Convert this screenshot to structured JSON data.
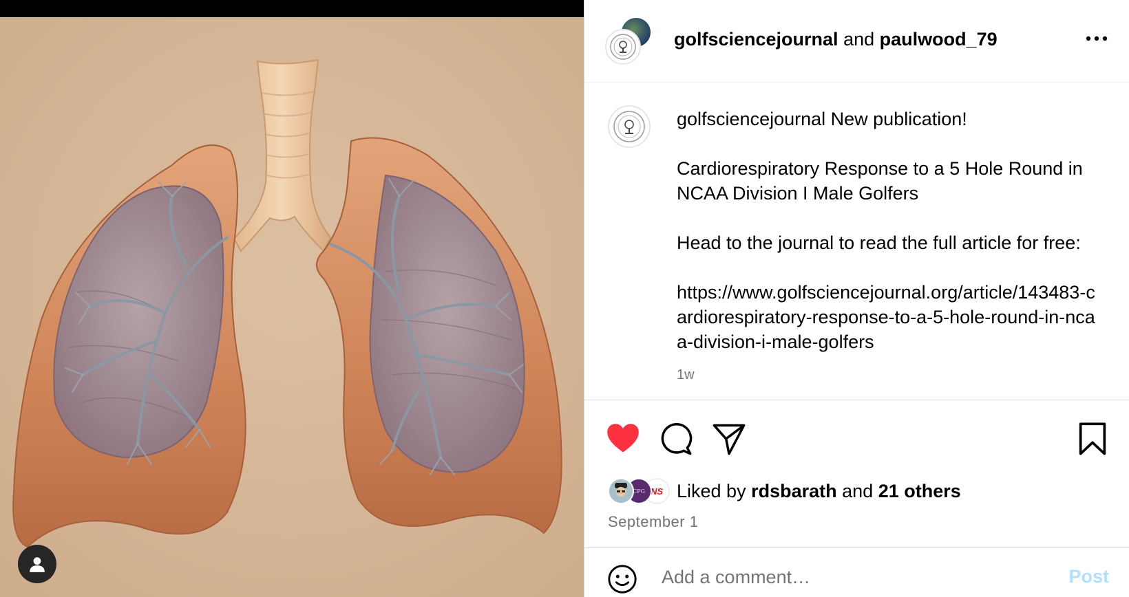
{
  "header": {
    "user1": "golfsciencejournal",
    "joiner": "and",
    "user2": "paulwood_79"
  },
  "caption": {
    "username": "golfsciencejournal",
    "line1": "New publication!",
    "title": "Cardiorespiratory Response to a 5 Hole Round in NCAA Division I Male Golfers",
    "cta": "Head to the journal to read the full article for free:",
    "link": "https://www.golfsciencejournal.org/article/143483-cardiorespiratory-response-to-a-5-hole-round-in-ncaa-division-i-male-golfers",
    "time": "1w"
  },
  "actions": {
    "like_icon": "heart-filled-icon",
    "comment_icon": "comment-icon",
    "share_icon": "send-icon",
    "save_icon": "bookmark-icon",
    "like_color": "#ff3040"
  },
  "likes": {
    "prefix": "Liked by",
    "user": "rdsbarath",
    "joiner": "and",
    "others": "21 others",
    "avatar_badges": [
      "",
      "CPG",
      "NS"
    ]
  },
  "date": "September 1",
  "comment": {
    "placeholder": "Add a comment…",
    "post_label": "Post"
  }
}
